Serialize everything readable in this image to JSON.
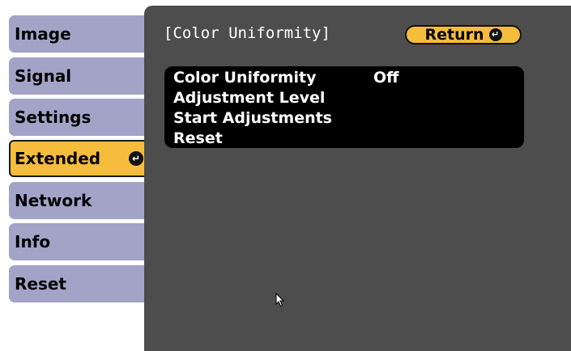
{
  "sidebar": {
    "items": [
      {
        "label": "Image"
      },
      {
        "label": "Signal"
      },
      {
        "label": "Settings"
      },
      {
        "label": "Extended",
        "active": true
      },
      {
        "label": "Network"
      },
      {
        "label": "Info"
      },
      {
        "label": "Reset"
      }
    ]
  },
  "panel": {
    "title": "[Color Uniformity]",
    "return_label": "Return",
    "menu": [
      {
        "label": "Color Uniformity",
        "value": "Off"
      },
      {
        "label": "Adjustment Level",
        "value": ""
      },
      {
        "label": "Start Adjustments",
        "value": ""
      },
      {
        "label": "Reset",
        "value": ""
      }
    ]
  },
  "icons": {
    "enter": "enter-icon",
    "cursor": "mouse-pointer-icon"
  },
  "colors": {
    "tab_bg": "#a3a3c8",
    "active_tab_bg": "#f6bc3c",
    "panel_bg": "#4d4d4d",
    "menu_bg": "#000000",
    "return_bg": "#f6bc3c"
  }
}
